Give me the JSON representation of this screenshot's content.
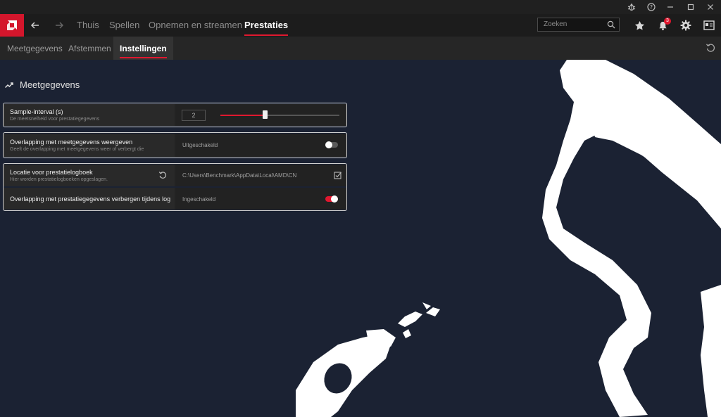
{
  "window": {
    "controls": [
      "bug-icon",
      "help-icon",
      "minimize-icon",
      "maximize-icon",
      "close-icon"
    ]
  },
  "nav": {
    "items": [
      {
        "label": "Thuis"
      },
      {
        "label": "Spellen"
      },
      {
        "label": "Opnemen en streamen"
      },
      {
        "label": "Prestaties"
      }
    ],
    "active": "Prestaties",
    "search_placeholder": "Zoeken",
    "notification_count": "3"
  },
  "subnav": {
    "tabs": [
      {
        "label": "Meetgegevens"
      },
      {
        "label": "Afstemmen"
      },
      {
        "label": "Instellingen"
      }
    ],
    "active": "Instellingen"
  },
  "section": {
    "title": "Meetgegevens"
  },
  "settings": [
    {
      "title": "Sample-interval (s)",
      "description": "De meetsnelheid voor prestatiegegevens",
      "value": "2",
      "slider_fraction": 0.37
    },
    {
      "title": "Overlapping met meetgegevens weergeven",
      "description": "Geeft de overlapping met meetgegevens weer of verbergt die",
      "value": "Uitgeschakeld",
      "enabled": false
    },
    {
      "title": "Locatie voor prestatielogboek",
      "description": "Hier worden prestatielogboeken opgeslagen.",
      "value": "C:\\Users\\Benchmark\\AppData\\Local\\AMD\\CN"
    },
    {
      "title": "Overlapping met prestatiegegevens verbergen tijdens logbo...",
      "description": "",
      "value": "Ingeschakeld",
      "enabled": true
    }
  ],
  "colors": {
    "accent": "#e0182f",
    "background": "#1b2233",
    "topbar": "#1c1c1c",
    "subbar": "#262626"
  }
}
